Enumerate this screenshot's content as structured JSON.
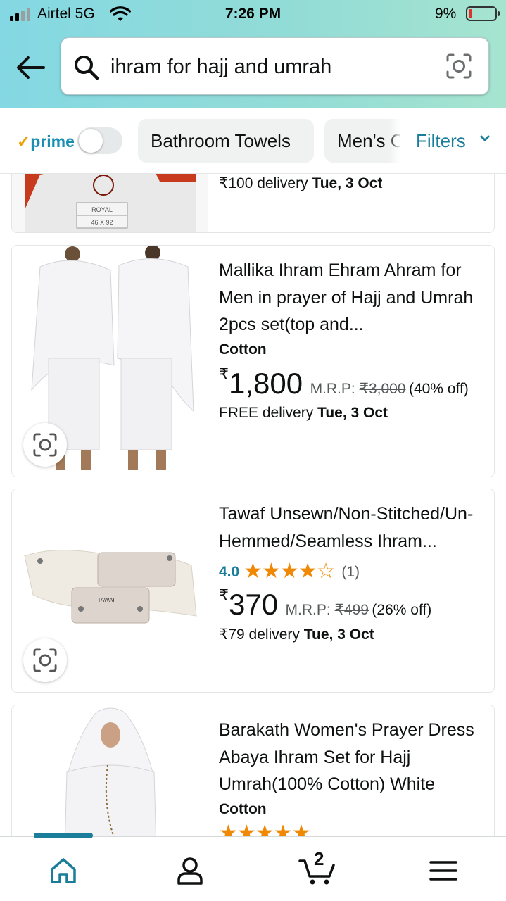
{
  "status_bar": {
    "carrier": "Airtel 5G",
    "time": "7:26 PM",
    "battery": "9%"
  },
  "search": {
    "value": "ihram for hajj and umrah",
    "back_icon": "back-arrow-icon",
    "search_icon": "magnifier-icon",
    "camera_icon": "camera-lens-icon"
  },
  "filters": {
    "prime_check": "✓",
    "prime_label": "prime",
    "prime_toggle_on": false,
    "chips": [
      "Bathroom Towels",
      "Men's C"
    ],
    "filters_label": "Filters"
  },
  "results": {
    "partial_item": {
      "image_text_1": "ROYAL",
      "image_text_2": "46 X 92",
      "delivery_text": "₹100 delivery",
      "delivery_date": "Tue, 3 Oct"
    },
    "items": [
      {
        "title": "Mallika Ihram Ehram Ahram for Men in prayer of Hajj and Umrah 2pcs set(top and...",
        "material": "Cotton",
        "currency": "₹",
        "price": "1,800",
        "mrp_label": "M.R.P:",
        "mrp": "₹3,000",
        "discount": "(40% off)",
        "delivery_text": "FREE delivery",
        "delivery_date": "Tue, 3 Oct"
      },
      {
        "title": "Tawaf Unsewn/Non-Stitched/Un-Hemmed/Seamless Ihram...",
        "rating": "4.0",
        "rating_value": 4.0,
        "stars": "★★★★☆",
        "reviews": "(1)",
        "currency": "₹",
        "price": "370",
        "mrp_label": "M.R.P:",
        "mrp": "₹499",
        "discount": "(26% off)",
        "delivery_text": "₹79 delivery",
        "delivery_date": "Tue, 3 Oct",
        "image_text": "TAWAF"
      },
      {
        "title": "Barakath Women's Prayer Dress Abaya Ihram Set for Hajj Umrah(100% Cotton) White",
        "material": "Cotton",
        "stars": "★★★★★"
      }
    ]
  },
  "bottom_nav": {
    "items": [
      "home-icon",
      "account-icon",
      "cart-icon",
      "menu-icon"
    ],
    "cart_count": "2",
    "active": "home-icon"
  },
  "colors": {
    "header_gradient": [
      "#84d8e3",
      "#a6e4cf"
    ],
    "link_teal": "#1a7d99",
    "star_orange": "#f08804",
    "battery_low": "#e0302a"
  }
}
